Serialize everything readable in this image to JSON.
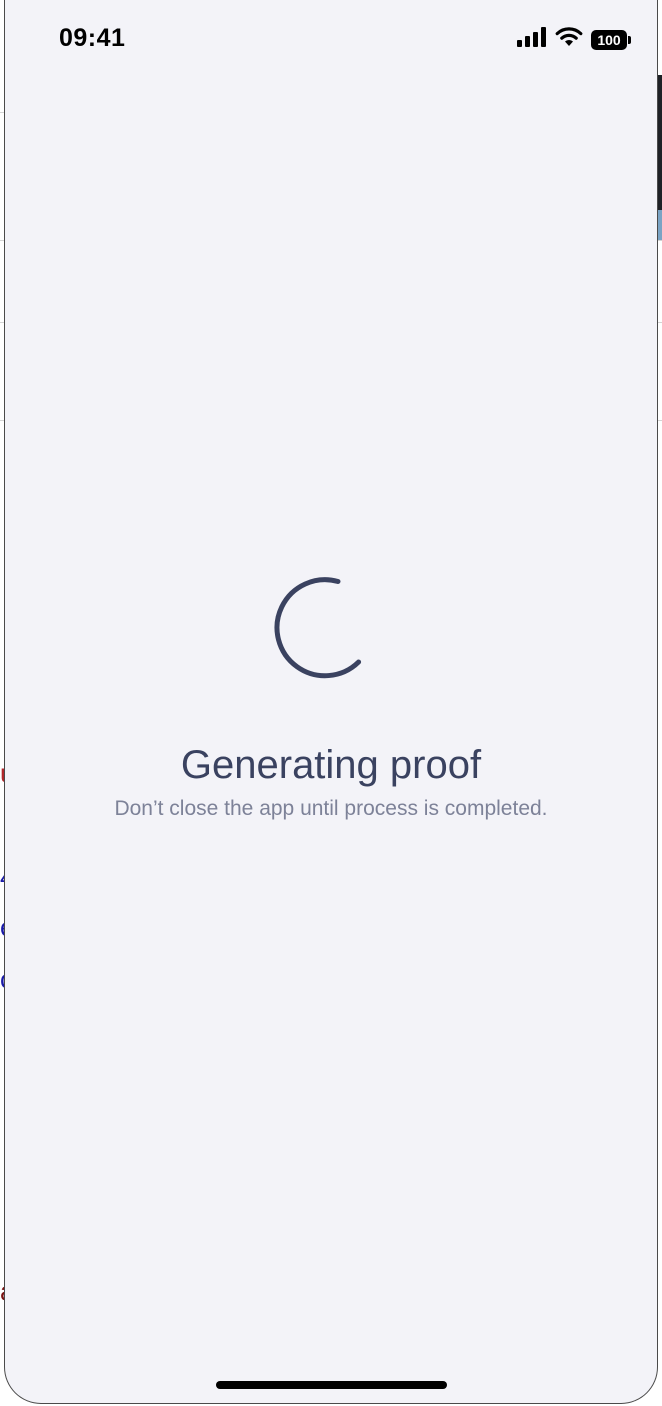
{
  "status_bar": {
    "time": "09:41",
    "battery": "100"
  },
  "loading": {
    "title": "Generating proof",
    "subtitle": "Don’t close the app until process is completed."
  },
  "colors": {
    "background": "#f3f3f8",
    "title": "#3a4260",
    "subtitle": "#7d8298",
    "spinner": "#3a4260"
  }
}
